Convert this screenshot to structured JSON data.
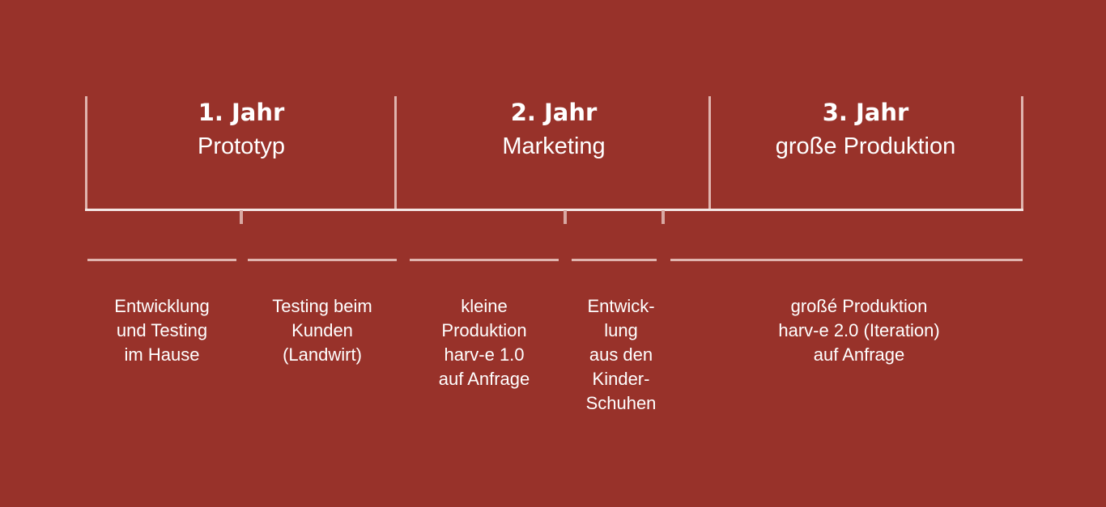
{
  "colors": {
    "background": "#98322a",
    "lines": "#e0b4ae",
    "text": "#ffffff"
  },
  "phases": [
    {
      "year": "1. Jahr",
      "title": "Prototyp"
    },
    {
      "year": "2. Jahr",
      "title": "Marketing"
    },
    {
      "year": "3. Jahr",
      "title": "große Produktion"
    }
  ],
  "steps": [
    {
      "text": "Entwicklung\nund Testing\nim Hause"
    },
    {
      "text": "Testing beim\nKunden\n(Landwirt)"
    },
    {
      "text": "kleine\nProduktion\nharv-e 1.0\nauf Anfrage"
    },
    {
      "text": "Entwick-\nlung\naus den\nKinder-\nSchuhen"
    },
    {
      "text": "großé Produktion\nharv-e 2.0 (Iteration)\nauf Anfrage"
    }
  ]
}
